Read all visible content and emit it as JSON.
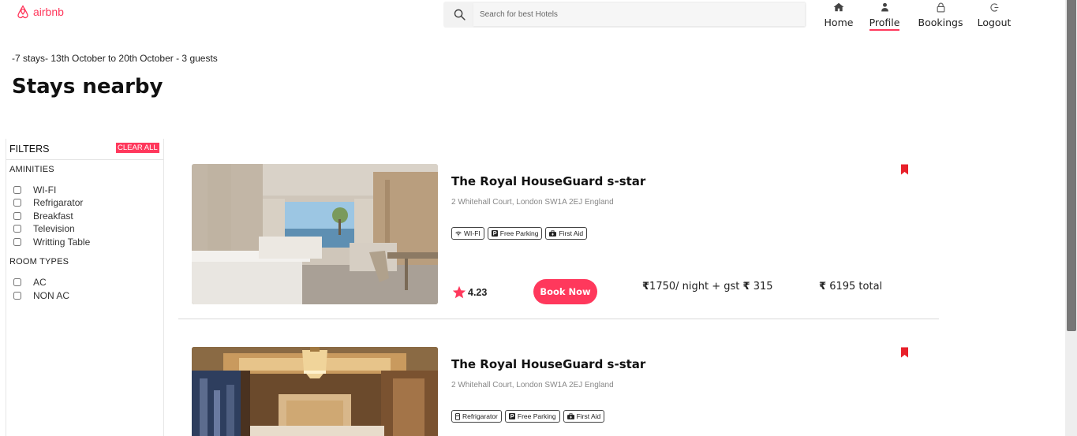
{
  "brand": {
    "logo_text": "airbnb",
    "color": "#ff385c"
  },
  "search": {
    "placeholder": "Search for best Hotels"
  },
  "nav": [
    {
      "label": "Home",
      "icon": "home-icon"
    },
    {
      "label": "Profile",
      "icon": "user-icon",
      "active": true
    },
    {
      "label": "Bookings",
      "icon": "lock-icon"
    },
    {
      "label": "Logout",
      "icon": "logout-icon"
    }
  ],
  "summary": "-7 stays- 13th October to 20th October - 3 guests",
  "page_title": "Stays nearby",
  "filters": {
    "title": "FILTERS",
    "clear_label": "CLEAR ALL",
    "amenities_label": "AMINITIES",
    "amenities": [
      "WI-FI",
      "Refrigarator",
      "Breakfast",
      "Television",
      "Writting Table"
    ],
    "room_types_label": "ROOM TYPES",
    "room_types": [
      "AC",
      "NON AC"
    ]
  },
  "listings": [
    {
      "name": "The Royal HouseGuard s-star",
      "address": "2 Whitehall Court, London SW1A 2EJ England",
      "tags": [
        {
          "label": "WI-FI",
          "icon": "wifi-icon"
        },
        {
          "label": "Free Parking",
          "icon": "parking-icon"
        },
        {
          "label": "First Aid",
          "icon": "first-aid-icon"
        }
      ],
      "rating": "4.23",
      "book_label": "Book Now",
      "currency": "₹",
      "price_text": "1750/ night + gst",
      "gst": "315",
      "total_amount": "6195",
      "total_label": "total"
    },
    {
      "name": "The Royal HouseGuard s-star",
      "address": "2 Whitehall Court, London SW1A 2EJ England",
      "tags": [
        {
          "label": "Refrigarator",
          "icon": "fridge-icon"
        },
        {
          "label": "Free Parking",
          "icon": "parking-icon"
        },
        {
          "label": "First Aid",
          "icon": "first-aid-icon"
        }
      ]
    }
  ]
}
